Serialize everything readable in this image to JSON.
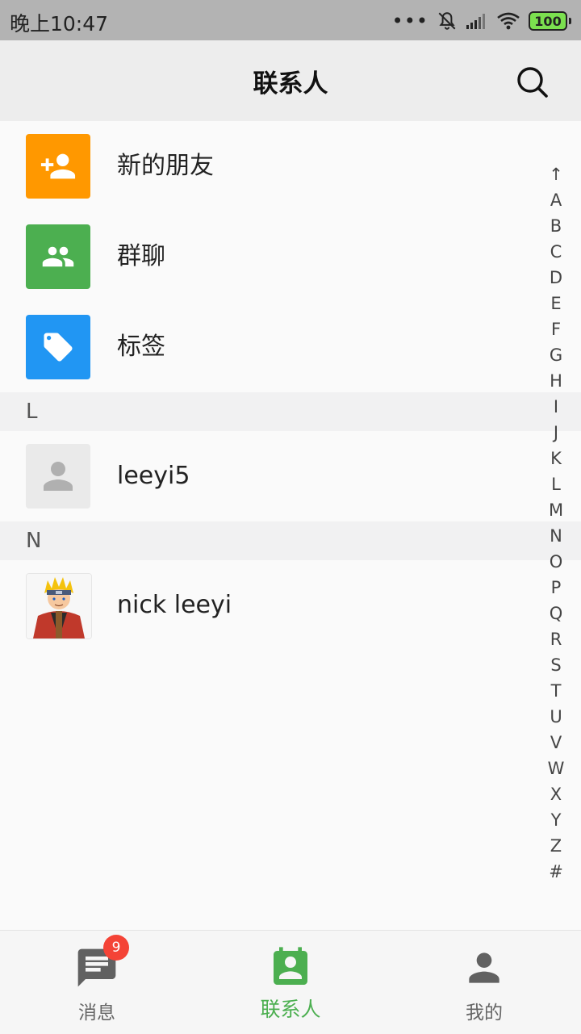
{
  "status_bar": {
    "time": "晚上10:47",
    "battery": "100",
    "dots": "•••"
  },
  "app_bar": {
    "title": "联系人"
  },
  "shortcuts": [
    {
      "label": "新的朋友",
      "icon": "person-add-icon",
      "color": "#ff9800"
    },
    {
      "label": "群聊",
      "icon": "group-icon",
      "color": "#4caf50"
    },
    {
      "label": "标签",
      "icon": "tag-icon",
      "color": "#2196f3"
    }
  ],
  "sections": [
    {
      "letter": "L",
      "contacts": [
        {
          "name": "leeyi5",
          "avatar": "default-person-avatar"
        }
      ]
    },
    {
      "letter": "N",
      "contacts": [
        {
          "name": "nick leeyi",
          "avatar": "naruto-avatar"
        }
      ]
    }
  ],
  "index_letters": [
    "↑",
    "A",
    "B",
    "C",
    "D",
    "E",
    "F",
    "G",
    "H",
    "I",
    "J",
    "K",
    "L",
    "M",
    "N",
    "O",
    "P",
    "Q",
    "R",
    "S",
    "T",
    "U",
    "V",
    "W",
    "X",
    "Y",
    "Z",
    "#"
  ],
  "bottom_nav": [
    {
      "label": "消息",
      "icon": "message-icon",
      "badge": "9",
      "active": false
    },
    {
      "label": "联系人",
      "icon": "contacts-icon",
      "active": true
    },
    {
      "label": "我的",
      "icon": "person-icon",
      "active": false
    }
  ],
  "colors": {
    "accent": "#4caf50",
    "badge": "#f44336"
  }
}
